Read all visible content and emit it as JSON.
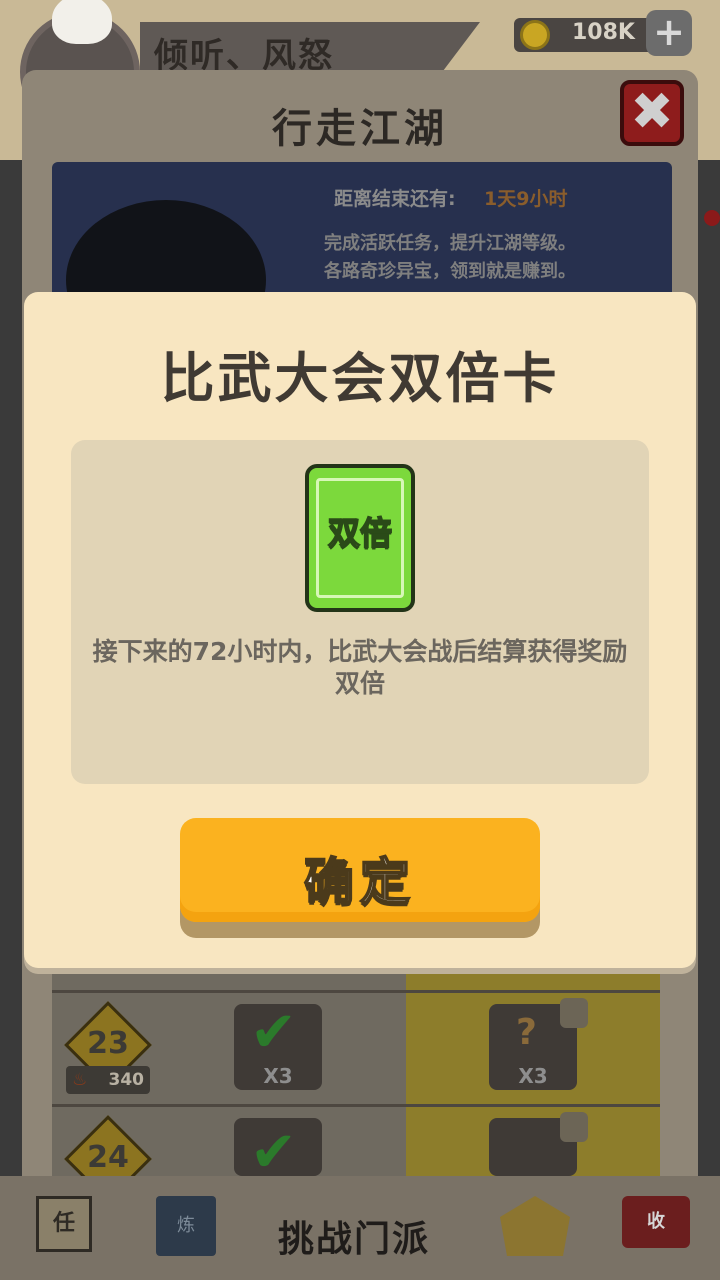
{
  "header": {
    "player_name": "倾听、风怒",
    "currency_amount": "108K",
    "add_currency_symbol": "+"
  },
  "panel": {
    "title": "行走江湖",
    "close_symbol": "✖",
    "event": {
      "time_label": "距离结束还有:",
      "time_value": "1天9小时",
      "description_line1": "完成活跃任务，提升江湖等级。",
      "description_line2": "各路奇珍异宝，领到就是赚到。"
    },
    "rows": [
      {
        "level": "23",
        "fire_value": "340",
        "left_count": "X3",
        "right_count": "X3"
      },
      {
        "level": "24"
      }
    ]
  },
  "bottom_nav": {
    "center_title": "挑战门派",
    "icon1_text": "任",
    "icon2_text": "炼",
    "icon4_text": "收"
  },
  "modal": {
    "title": "比武大会双倍卡",
    "card_label": "双倍",
    "description": "接下来的72小时内，比武大会战后结算获得奖励双倍",
    "confirm_label": "确定"
  },
  "colors": {
    "modal_bg": "#f8e6c1",
    "modal_inner_bg": "#e1d4b6",
    "card_green": "#7cd93c",
    "confirm_orange": "#fbb21f",
    "close_red": "#8e1c1c"
  }
}
